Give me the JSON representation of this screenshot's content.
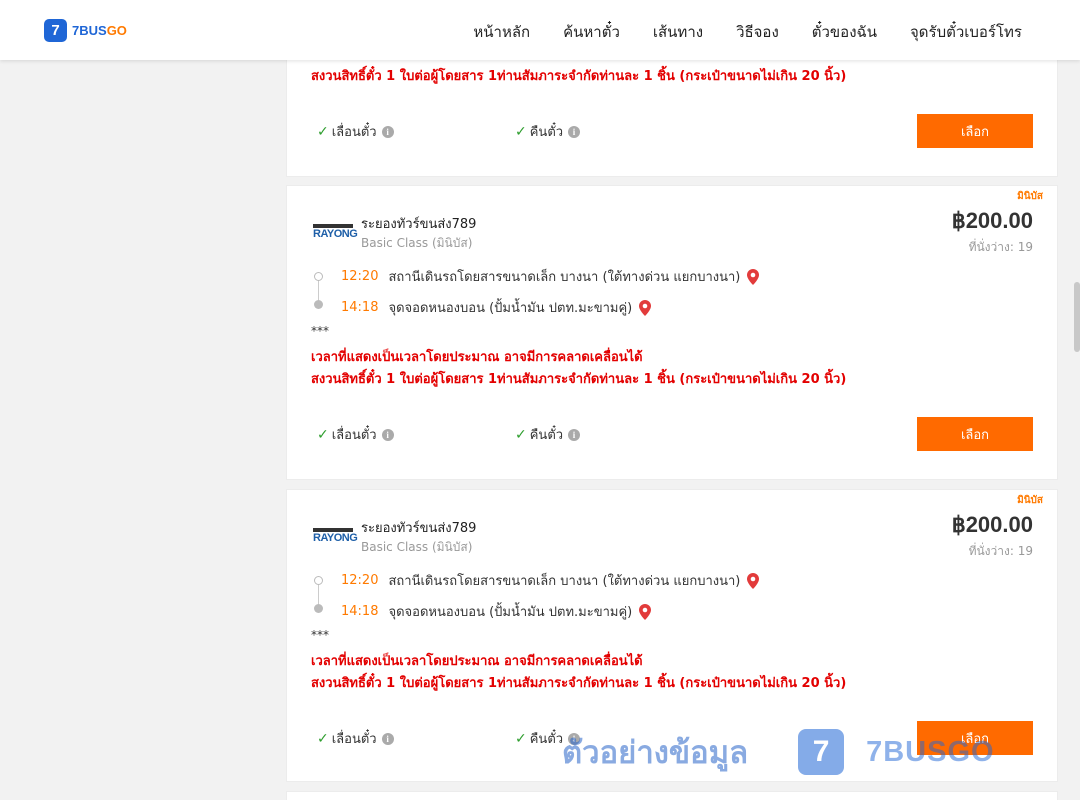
{
  "logo": {
    "mark": "7",
    "brand_main": "7BUS",
    "brand_accent": "GO"
  },
  "nav": [
    "หน้าหลัก",
    "ค้นหาตั๋ว",
    "เส้นทาง",
    "วิธีจอง",
    "ตั๋วของฉัน",
    "จุดรับตั๋วเบอร์โทร"
  ],
  "colors": {
    "accent": "#ff6a00",
    "brand": "#1f66d6",
    "warning": "#e30000"
  },
  "card_top": {
    "note": "สงวนสิทธิ์ตั๋ว 1 ใบต่อผู้โดยสาร 1ท่านสัมภาระจำกัดท่านละ 1 ชิ้น (กระเป๋าขนาดไม่เกิน 20 นิ้ว)",
    "feature1": "เลื่อนตั๋ว",
    "feature2": "คืนตั๋ว",
    "button": "เลือก"
  },
  "trips": [
    {
      "badge": "มินิบัส",
      "logo_text": "RAYONG",
      "operator": "ระยองทัวร์ขนส่ง789",
      "class": "Basic Class (มินิบัส)",
      "price": "฿200.00",
      "seats": "ที่นั่งว่าง: 19",
      "depart_time": "12:20",
      "depart_place": "สถานีเดินรถโดยสารขนาดเล็ก บางนา (ใต้ทางด่วน แยกบางนา)",
      "arrive_time": "14:18",
      "arrive_place": "จุดจอดหนองบอน (ปั้มน้ำมัน ปตท.มะขามคู่)",
      "stars": "***",
      "note1": "เวลาที่แสดงเป็นเวลาโดยประมาณ อาจมีการคลาดเคลื่อนได้",
      "note2": "สงวนสิทธิ์ตั๋ว 1 ใบต่อผู้โดยสาร 1ท่านสัมภาระจำกัดท่านละ 1 ชิ้น (กระเป๋าขนาดไม่เกิน 20 นิ้ว)",
      "feature1": "เลื่อนตั๋ว",
      "feature2": "คืนตั๋ว",
      "button": "เลือก"
    },
    {
      "badge": "มินิบัส",
      "logo_text": "RAYONG",
      "operator": "ระยองทัวร์ขนส่ง789",
      "class": "Basic Class (มินิบัส)",
      "price": "฿200.00",
      "seats": "ที่นั่งว่าง: 19",
      "depart_time": "12:20",
      "depart_place": "สถานีเดินรถโดยสารขนาดเล็ก บางนา (ใต้ทางด่วน แยกบางนา)",
      "arrive_time": "14:18",
      "arrive_place": "จุดจอดหนองบอน (ปั้มน้ำมัน ปตท.มะขามคู่)",
      "stars": "***",
      "note1": "เวลาที่แสดงเป็นเวลาโดยประมาณ อาจมีการคลาดเคลื่อนได้",
      "note2": "สงวนสิทธิ์ตั๋ว 1 ใบต่อผู้โดยสาร 1ท่านสัมภาระจำกัดท่านละ 1 ชิ้น (กระเป๋าขนาดไม่เกิน 20 นิ้ว)",
      "feature1": "เลื่อนตั๋ว",
      "feature2": "คืนตั๋ว",
      "button": "เลือก"
    }
  ],
  "watermark": {
    "text": "ตัวอย่างข้อมูล",
    "mark": "7",
    "brand": "7BUSGO"
  }
}
